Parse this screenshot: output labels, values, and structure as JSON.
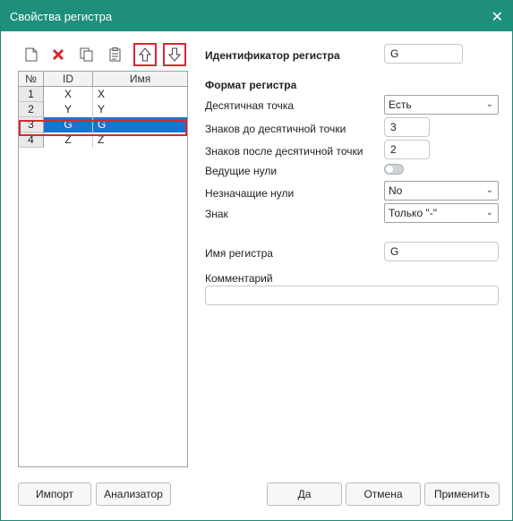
{
  "window": {
    "title": "Свойства регистра",
    "close_icon": "close-icon"
  },
  "toolbar": {
    "icons": [
      "new-icon",
      "delete-icon",
      "copy-icon",
      "paste-icon",
      "move-up-icon",
      "move-down-icon"
    ],
    "delete_color": "#d9282f",
    "highlight_color": "#d9282f"
  },
  "table": {
    "headers": [
      "№",
      "ID",
      "Имя"
    ],
    "rows": [
      {
        "idx": "1",
        "id": "X",
        "name": "X"
      },
      {
        "idx": "2",
        "id": "Y",
        "name": "Y"
      },
      {
        "idx": "3",
        "id": "G",
        "name": "G"
      },
      {
        "idx": "4",
        "id": "Z",
        "name": "Z"
      }
    ],
    "selected_index": 2,
    "selection_color": "#1476d4"
  },
  "form": {
    "register_id_label": "Идентификатор регистра",
    "register_id_value": "G",
    "format_section": "Формат регистра",
    "decimal_point_label": "Десятичная точка",
    "decimal_point_value": "Есть",
    "digits_before_label": "Знаков до десятичной точки",
    "digits_before_value": "3",
    "digits_after_label": "Знаков после десятичной точки",
    "digits_after_value": "2",
    "leading_zeros_label": "Ведущие нули",
    "leading_zeros_on": false,
    "trailing_zeros_label": "Незначащие нули",
    "trailing_zeros_value": "No",
    "sign_label": "Знак",
    "sign_value": "Только \"-\"",
    "register_name_label": "Имя регистра",
    "register_name_value": "G",
    "comment_label": "Комментарий",
    "comment_value": ""
  },
  "buttons": {
    "import": "Импорт",
    "analyzer": "Анализатор",
    "yes": "Да",
    "cancel": "Отмена",
    "apply": "Применить"
  },
  "colors": {
    "titlebar": "#1f8f7d"
  }
}
